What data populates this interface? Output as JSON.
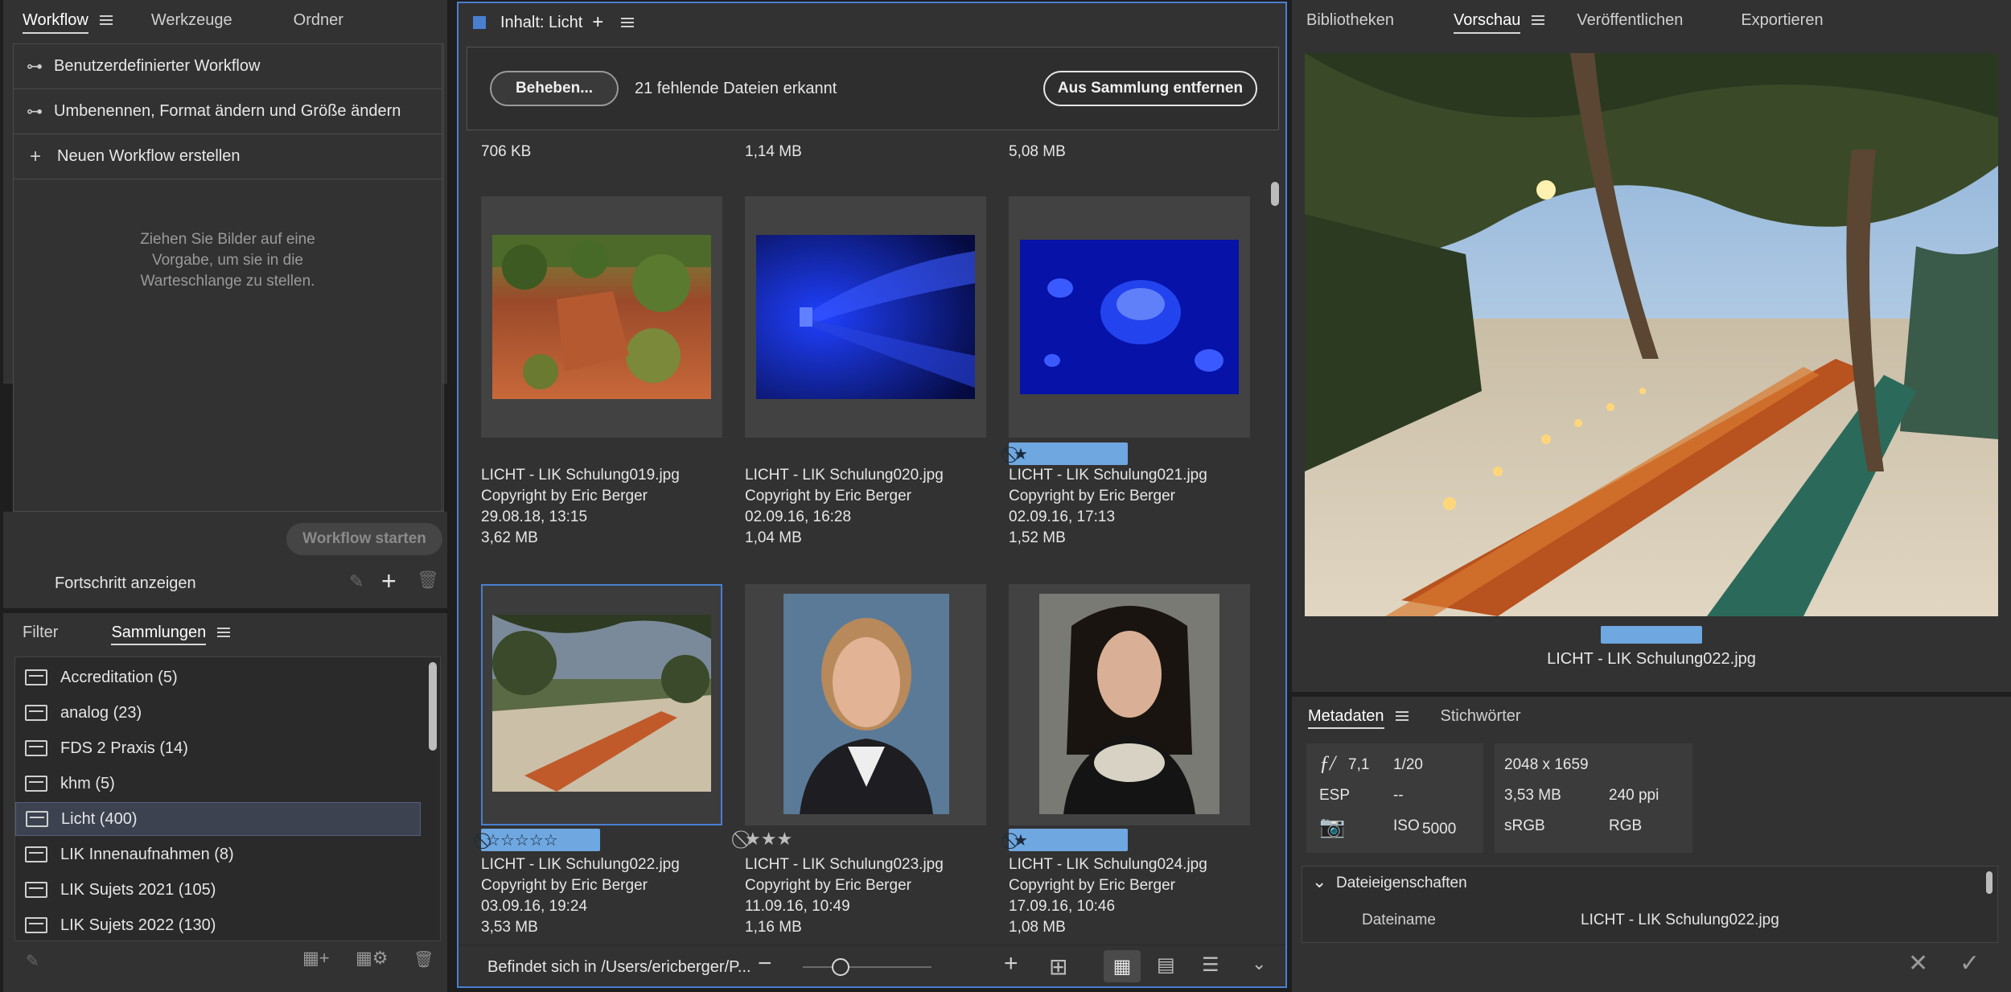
{
  "left_top": {
    "tabs": [
      {
        "label": "Workflow",
        "active": true
      },
      {
        "label": "Werkzeuge",
        "active": false
      },
      {
        "label": "Ordner",
        "active": false
      }
    ],
    "workflows": [
      "Benutzerdefinierter Workflow",
      "Umbenennen, Format ändern und Größe ändern"
    ],
    "new_workflow": "Neuen Workflow erstellen",
    "drop_hint": [
      "Ziehen Sie Bilder auf eine",
      "Vorgabe, um sie in die",
      "Warteschlange zu stellen."
    ],
    "start_button": "Workflow starten",
    "progress_label": "Fortschritt anzeigen"
  },
  "left_bottom": {
    "tabs": [
      {
        "label": "Filter",
        "active": false
      },
      {
        "label": "Sammlungen",
        "active": true
      }
    ],
    "collections": [
      {
        "label": "Accreditation (5)",
        "selected": false
      },
      {
        "label": "analog (23)",
        "selected": false
      },
      {
        "label": "FDS 2 Praxis (14)",
        "selected": false
      },
      {
        "label": "khm (5)",
        "selected": false
      },
      {
        "label": "Licht (400)",
        "selected": true
      },
      {
        "label": "LIK Innenaufnahmen (8)",
        "selected": false
      },
      {
        "label": "LIK Sujets 2021 (105)",
        "selected": false
      },
      {
        "label": "LIK Sujets 2022 (130)",
        "selected": false
      }
    ]
  },
  "content": {
    "title": "Inhalt: Licht",
    "fix_button": "Beheben...",
    "missing_text": "21 fehlende Dateien erkannt",
    "remove_button": "Aus Sammlung entfernen",
    "top_sizes": [
      "706 KB",
      "1,14 MB",
      "5,08 MB"
    ],
    "items": [
      {
        "name": "LICHT - LIK Schulung019.jpg",
        "copyright": "Copyright by Eric Berger",
        "date": "29.08.18, 13:15",
        "size": "3,62 MB",
        "rating": null
      },
      {
        "name": "LICHT - LIK Schulung020.jpg",
        "copyright": "Copyright by Eric Berger",
        "date": "02.09.16, 16:28",
        "size": "1,04 MB",
        "rating": null
      },
      {
        "name": "LICHT - LIK Schulung021.jpg",
        "copyright": "Copyright by Eric Berger",
        "date": "02.09.16, 17:13",
        "size": "1,52 MB",
        "rating": "⃠★"
      },
      {
        "name": "LICHT - LIK Schulung022.jpg",
        "copyright": "Copyright by Eric Berger",
        "date": "03.09.16, 19:24",
        "size": "3,53 MB",
        "rating": "⃠☆☆☆☆☆"
      },
      {
        "name": "LICHT - LIK Schulung023.jpg",
        "copyright": "Copyright by Eric Berger",
        "date": "11.09.16, 10:49",
        "size": "1,16 MB",
        "rating": "⃠★★★"
      },
      {
        "name": "LICHT - LIK Schulung024.jpg",
        "copyright": "Copyright by Eric Berger",
        "date": "17.09.16, 10:46",
        "size": "1,08 MB",
        "rating": "⃠★"
      }
    ],
    "path_text": "Befindet sich in /Users/ericberger/P..."
  },
  "right_top": {
    "tabs": [
      {
        "label": "Bibliotheken",
        "active": false
      },
      {
        "label": "Vorschau",
        "active": true
      },
      {
        "label": "Veröffentlichen",
        "active": false
      },
      {
        "label": "Exportieren",
        "active": false
      }
    ],
    "caption": "LICHT - LIK Schulung022.jpg"
  },
  "metadata": {
    "tabs": [
      {
        "label": "Metadaten",
        "active": true
      },
      {
        "label": "Stichwörter",
        "active": false
      }
    ],
    "aperture": "7,1",
    "shutter": "1/20",
    "esp_label": "ESP",
    "esp_value": "--",
    "iso_label": "ISO",
    "iso_value": "5000",
    "dimensions": "2048 x 1659",
    "filesize": "3,53 MB",
    "ppi": "240 ppi",
    "colorspace": "sRGB",
    "colormode": "RGB",
    "section_title": "Dateieigenschaften",
    "filename_label": "Dateiname",
    "filename_value": "LICHT - LIK Schulung022.jpg"
  },
  "colors": {
    "accent": "#4a7fd0",
    "rating": "#6fa7e0",
    "panel": "#323232"
  }
}
